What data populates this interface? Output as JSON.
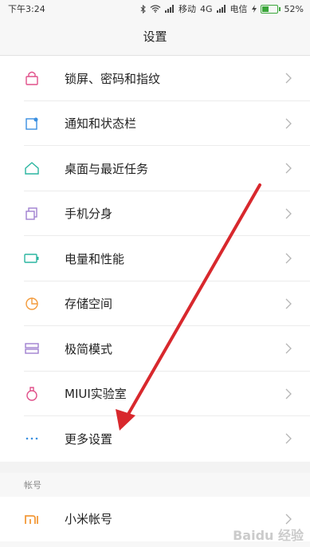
{
  "status": {
    "time": "下午3:24",
    "carrier1": "移动",
    "network": "4G",
    "carrier2": "电信",
    "battery_percent": "52%",
    "battery_level": 0.52
  },
  "header": {
    "title": "设置"
  },
  "settings": [
    {
      "label": "锁屏、密码和指纹",
      "icon": "lock-icon",
      "color": "#e0508a"
    },
    {
      "label": "通知和状态栏",
      "icon": "notification-icon",
      "color": "#3a8fe0"
    },
    {
      "label": "桌面与最近任务",
      "icon": "home-icon",
      "color": "#2ab5a0"
    },
    {
      "label": "手机分身",
      "icon": "clone-icon",
      "color": "#a07fd0"
    },
    {
      "label": "电量和性能",
      "icon": "battery-icon",
      "color": "#2ab5a0"
    },
    {
      "label": "存储空间",
      "icon": "storage-pie-icon",
      "color": "#f39a3a"
    },
    {
      "label": "极简模式",
      "icon": "simple-mode-icon",
      "color": "#a07fd0"
    },
    {
      "label": "MIUI实验室",
      "icon": "flask-icon",
      "color": "#e0508a"
    },
    {
      "label": "更多设置",
      "icon": "more-dots-icon",
      "color": "#3a8fe0"
    }
  ],
  "account_section": {
    "title": "帐号",
    "items": [
      {
        "label": "小米帐号",
        "icon": "mi-logo-icon",
        "color": "#f39a3a"
      }
    ]
  },
  "watermark": "Baidu 经验"
}
